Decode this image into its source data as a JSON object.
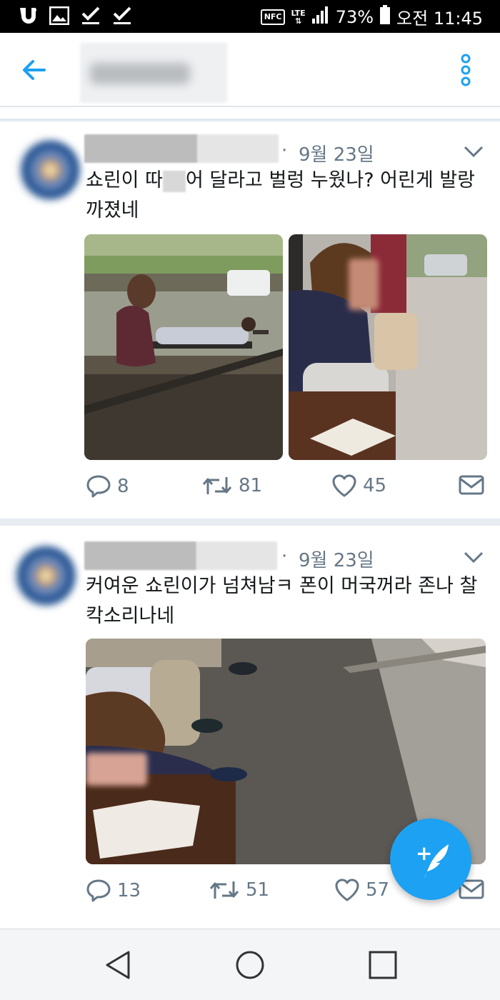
{
  "status_bar": {
    "battery_percent": "73%",
    "time": "오전 11:45",
    "nfc": "NFC",
    "lte": "LTE",
    "icons": [
      "carrier-u-icon",
      "gallery-icon",
      "checkmark-icon",
      "checkmark-icon",
      "nfc-icon",
      "lte-icon",
      "signal-icon",
      "battery-icon"
    ]
  },
  "app_bar": {
    "icons": [
      "back-arrow-icon",
      "more-vertical-icon"
    ],
    "accent_color": "#1da1f2"
  },
  "tweets": [
    {
      "date": "9월 23일",
      "text_part1": "쇼린이 따",
      "text_part2": "어 달라고 벌렁 누웠나? 어린게 발랑 까졌네",
      "replies": "8",
      "retweets": "81",
      "likes": "45"
    },
    {
      "date": "9월 23일",
      "text": "커여운 쇼린이가 넘쳐남ㅋ 폰이 머국꺼라 존나 찰칵소리나네",
      "replies": "13",
      "retweets": "51",
      "likes": "57"
    }
  ],
  "separator": "·",
  "fab": {
    "icon": "compose-tweet-icon",
    "plus": "+"
  },
  "nav_bar": {
    "icons": [
      "nav-back-icon",
      "nav-home-icon",
      "nav-recents-icon"
    ]
  }
}
